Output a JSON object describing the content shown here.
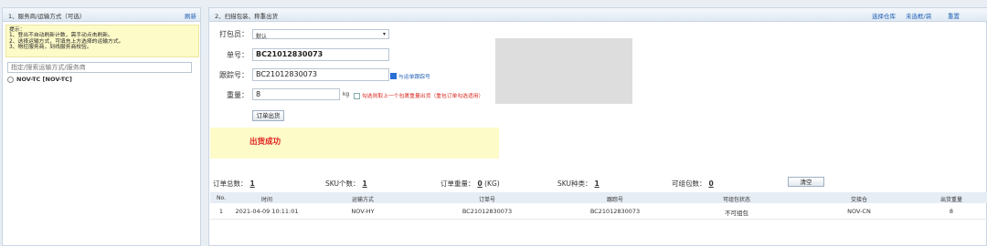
{
  "left_panel": {
    "title": "1、服务商/运输方式（可选）",
    "refresh": "刷新",
    "hint": {
      "title": "提示：",
      "lines": [
        "1、登出不自动刷新计数，需手动点击刷新。",
        "2、选择运输方式，可填充上方选择的运输方式。",
        "3、物控服务商，到线服务商校验。"
      ]
    },
    "search_placeholder": "指定/搜索运输方式/服务商",
    "tree_item": "NOV-TC [NOV-TC]"
  },
  "main": {
    "title": "2、扫描包装、称重出货",
    "links": [
      "选择仓库",
      "未选框/袋",
      "重置"
    ],
    "form": {
      "packer_label": "打包员：",
      "packer_value": "默认",
      "order_label": "单号：",
      "order_value": "BC21012830073",
      "tracking_label": "跟踪号：",
      "tracking_value": "BC21012830073",
      "tracking_check": "与运单跟踪号",
      "weight_label": "重量：",
      "weight_value": "8",
      "weight_unit": "kg",
      "weight_check": "勾选则取上一个包裹重量出货（重包订单勾选适用）",
      "submit": "订单出货"
    },
    "status_message": "出货成功",
    "stats": [
      {
        "label": "订单总数：",
        "value": "1"
      },
      {
        "label": "SKU个数：",
        "value": "1"
      },
      {
        "label": "订单重量：",
        "value": "0",
        "unit": "(KG)"
      },
      {
        "label": "SKU种类：",
        "value": "1"
      },
      {
        "label": "可组包数：",
        "value": "0"
      }
    ],
    "clear_button": "清空",
    "table": {
      "headers": [
        "No.",
        "时间",
        "运输方式",
        "订单号",
        "跟踪号",
        "可组包状态",
        "交接仓",
        "出货重量"
      ],
      "rows": [
        [
          "1",
          "2021-04-09 10:11:01",
          "NOV-HY",
          "BC21012830073",
          "BC21012830073",
          "不可组包",
          "NOV-CN",
          "8"
        ]
      ]
    }
  }
}
